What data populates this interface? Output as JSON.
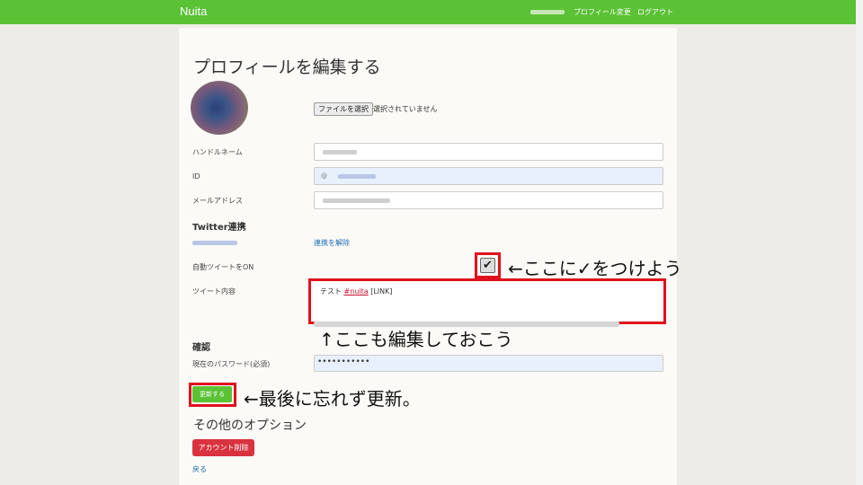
{
  "navbar": {
    "brand": "Nuita",
    "profile_link": "プロフィール変更",
    "logout_link": "ログアウト"
  },
  "page": {
    "title": "プロフィールを編集する"
  },
  "avatar_upload": {
    "button_label": "ファイルを選択",
    "status": "選択されていません"
  },
  "fields": {
    "handle_label": "ハンドルネーム",
    "id_label": "ID",
    "id_prefix": "@",
    "email_label": "メールアドレス"
  },
  "twitter": {
    "section_title": "Twitter連携",
    "unlink_label": "連携を解除",
    "auto_tweet_label": "自動ツイートをON",
    "checkbox_mark": "✔",
    "tweet_content_label": "ツイート内容",
    "tweet_text_prefix": "テスト ",
    "tweet_hashtag": "#nuita",
    "tweet_text_suffix": " [LINK]"
  },
  "confirm": {
    "section_title": "確認",
    "password_label": "現在のパスワード(必須)",
    "password_value": "•••••••••••",
    "update_button": "更新する"
  },
  "other": {
    "section_title": "その他のオプション",
    "delete_button": "アカウント削除",
    "back_link": "戻る"
  },
  "annotations": {
    "checkbox_note": "←ここに✓をつけよう",
    "tweet_note": "↑ここも編集しておこう",
    "update_note": "←最後に忘れず更新。"
  },
  "colors": {
    "brand_green": "#5bc236",
    "danger_red": "#d9333f",
    "annotation_red": "#e0101e",
    "link_blue": "#1f6fb5"
  }
}
